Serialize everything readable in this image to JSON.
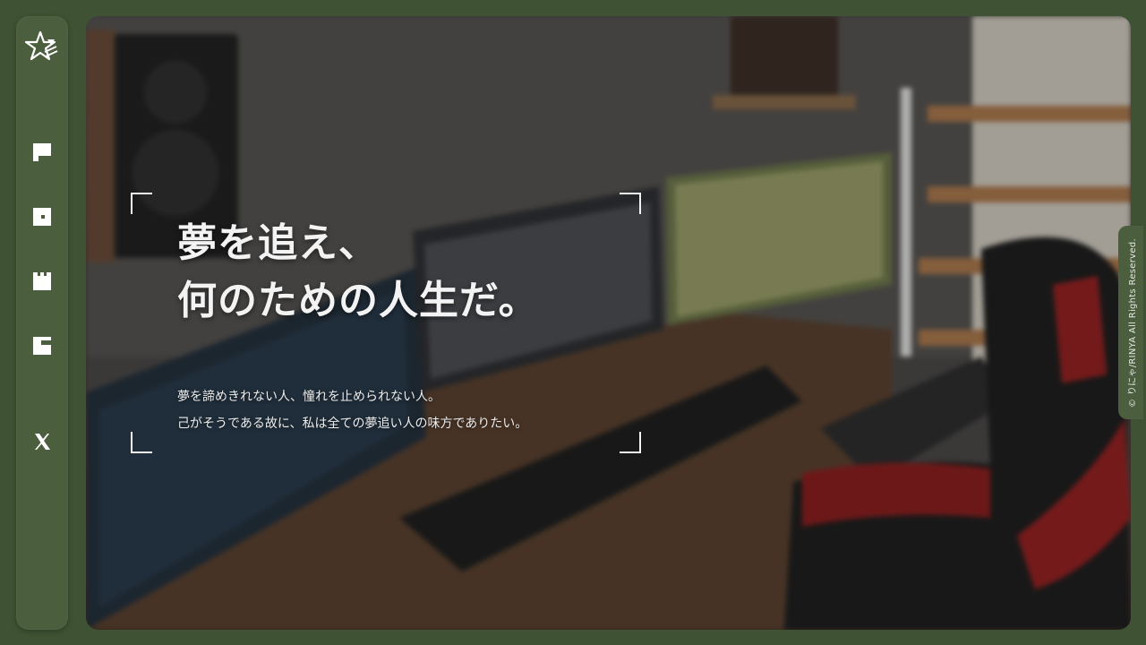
{
  "sidebar": {
    "logo_icon": "star-logo-icon",
    "items": [
      {
        "icon": "nav-square-icon-1",
        "name": "nav-item-1"
      },
      {
        "icon": "nav-square-icon-2",
        "name": "nav-item-2"
      },
      {
        "icon": "nav-square-icon-3",
        "name": "nav-item-3"
      },
      {
        "icon": "nav-square-icon-4",
        "name": "nav-item-4"
      },
      {
        "icon": "x-social-icon",
        "name": "nav-item-x"
      }
    ]
  },
  "hero": {
    "headline_line1": "夢を追え、",
    "headline_line2": "何のための人生だ。",
    "subtext_line1": "夢を諦めきれない人、憧れを止められない人。",
    "subtext_line2": "己がそうである故に、私は全ての夢追い人の味方でありたい。"
  },
  "footer": {
    "copyright": "© りにゃ/RINYA All Rights Reserved."
  },
  "colors": {
    "background": "#3f5233",
    "sidebar": "#4b5e3d",
    "text": "#f3f3f3"
  }
}
